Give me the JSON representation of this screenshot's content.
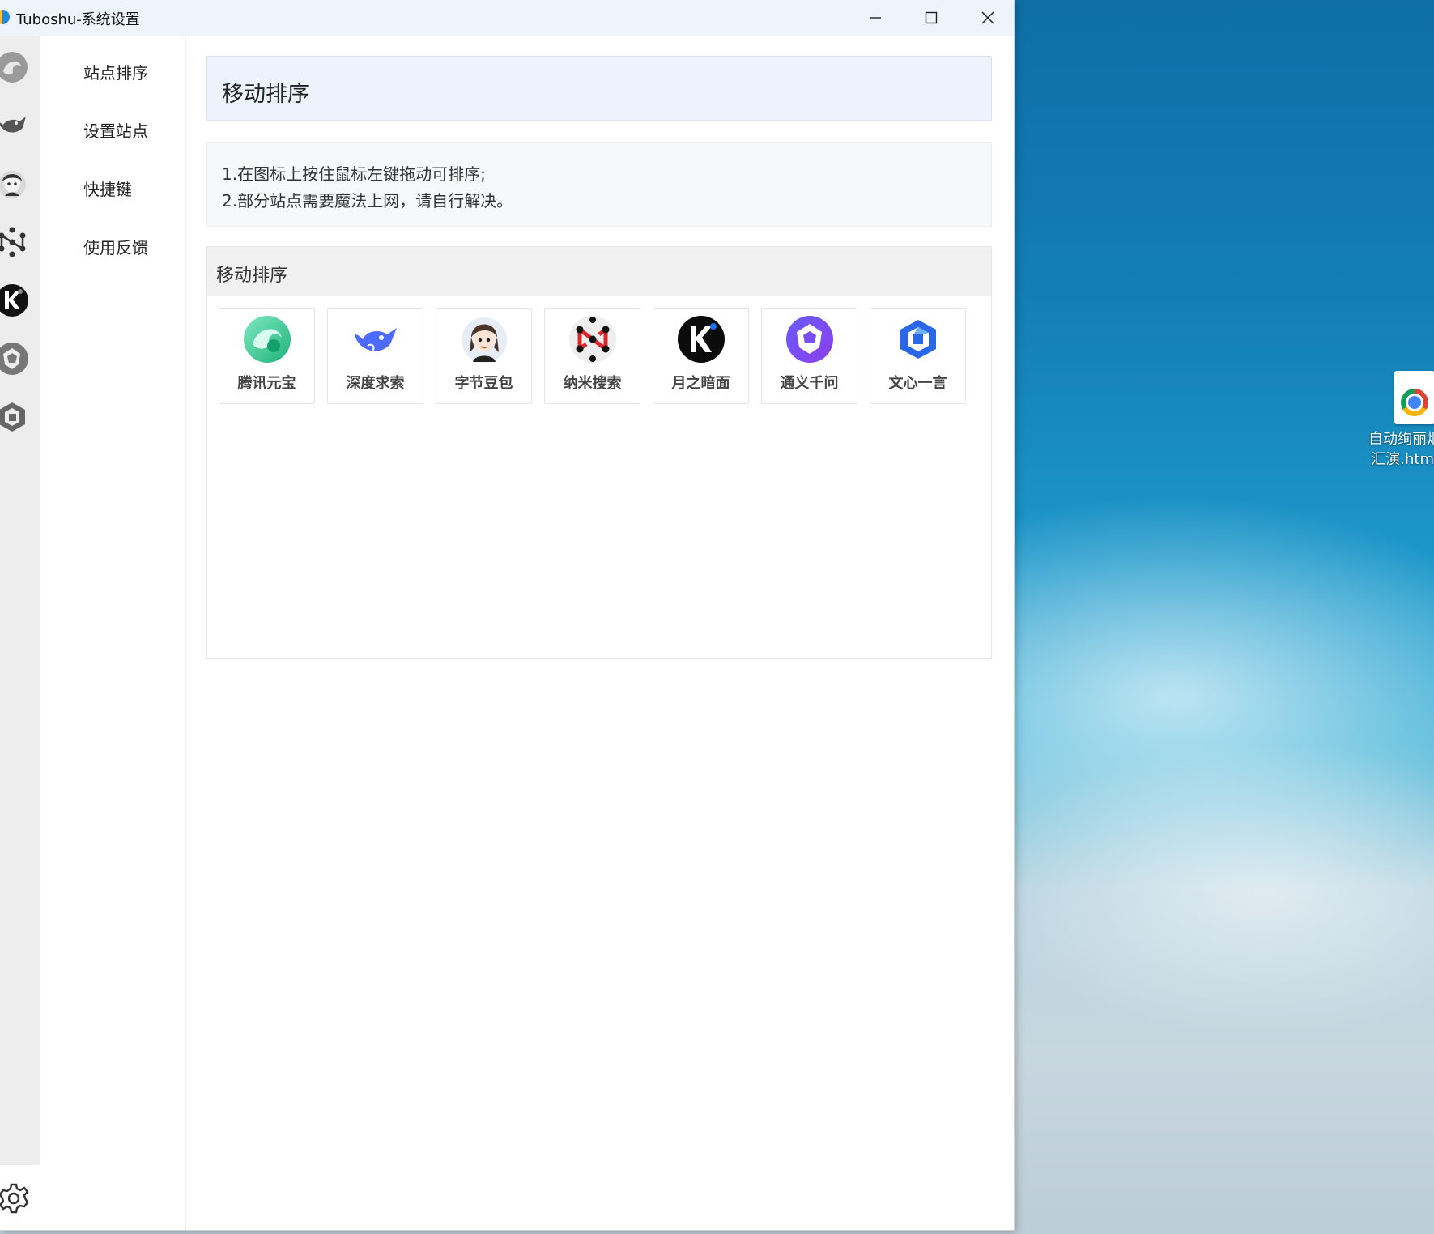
{
  "window": {
    "title": "Tuboshu-系统设置"
  },
  "nav": {
    "items": [
      {
        "label": "站点排序"
      },
      {
        "label": "设置站点"
      },
      {
        "label": "快捷键"
      },
      {
        "label": "使用反馈"
      }
    ]
  },
  "main": {
    "header_title": "移动排序",
    "info_lines": [
      "1.在图标上按住鼠标左键拖动可排序;",
      "2.部分站点需要魔法上网，请自行解决。"
    ],
    "panel_title": "移动排序",
    "tiles": [
      {
        "label": "腾讯元宝",
        "icon": "yuanbao-icon"
      },
      {
        "label": "深度求索",
        "icon": "deepseek-icon"
      },
      {
        "label": "字节豆包",
        "icon": "doubao-icon"
      },
      {
        "label": "纳米搜索",
        "icon": "nami-icon"
      },
      {
        "label": "月之暗面",
        "icon": "kimi-icon"
      },
      {
        "label": "通义千问",
        "icon": "tongyi-icon"
      },
      {
        "label": "文心一言",
        "icon": "wenxin-icon"
      }
    ]
  },
  "desktop": {
    "file_icon_label_line1": "自动绚丽烟",
    "file_icon_label_line2": "汇演.htm"
  },
  "colors": {
    "header_bg": "#ecf3fd",
    "rail_bg": "#ededed",
    "titlebar_bg": "#eef4fb"
  }
}
